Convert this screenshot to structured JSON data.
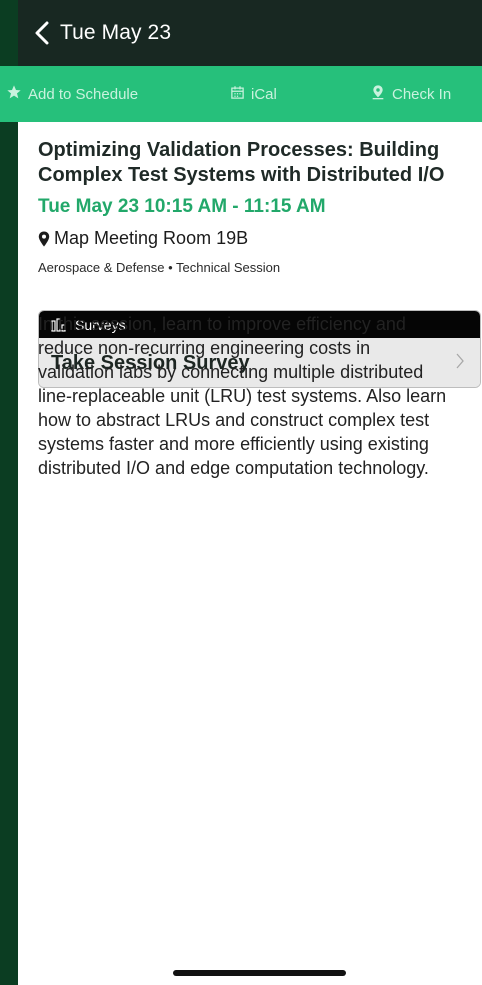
{
  "nav": {
    "back_label": "Tue May 23"
  },
  "actions": {
    "add_to_schedule": "Add to Schedule",
    "ical": "iCal",
    "check_in": "Check In"
  },
  "session": {
    "title": "Optimizing Validation Processes: Building Complex Test Systems with Distributed I/O",
    "time": "Tue May 23 10:15 AM - 11:15 AM",
    "location": "Map Meeting Room 19B",
    "tags": "Aerospace & Defense • Technical Session"
  },
  "surveys": {
    "header": "Surveys",
    "item_label": "Take Session Survey"
  },
  "description": "In this session, learn to improve efficiency and reduce non-recurring engineering costs in validation labs by connecting multiple distributed line-replaceable unit (LRU) test systems. Also learn how to abstract LRUs and construct complex test systems faster and more efficiently using existing distributed I/O and edge computation technology.",
  "colors": {
    "nav_bg": "#182822",
    "action_bar_bg": "#26c07b",
    "accent_green": "#22a86a",
    "side_strip": "#0b3d22"
  },
  "icons": {
    "back": "chevron-left-icon",
    "add": "star-icon",
    "ical": "calendar-icon",
    "check_in": "map-pin-icon",
    "location": "pin-icon",
    "surveys": "bar-chart-icon",
    "survey_item": "chevron-right-icon"
  }
}
